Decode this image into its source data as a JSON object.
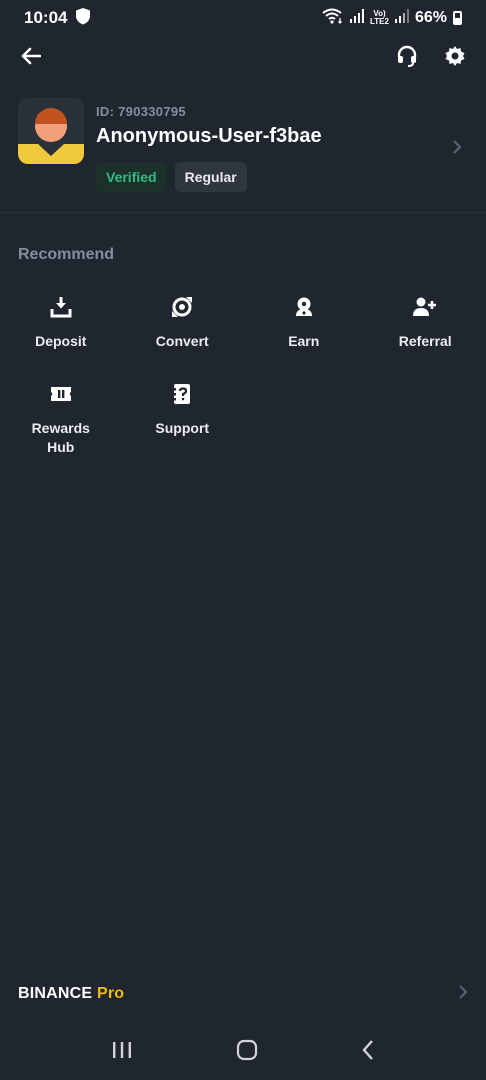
{
  "status_bar": {
    "time": "10:04",
    "net_top": "Vo)",
    "net_bottom": "LTE2",
    "battery": "66%"
  },
  "profile": {
    "id_text": "ID: 790330795",
    "username": "Anonymous-User-f3bae",
    "badge_verified": "Verified",
    "badge_regular": "Regular"
  },
  "section": {
    "title": "Recommend"
  },
  "shortcuts": [
    {
      "label": "Deposit",
      "icon": "deposit-icon"
    },
    {
      "label": "Convert",
      "icon": "convert-icon"
    },
    {
      "label": "Earn",
      "icon": "earn-icon"
    },
    {
      "label": "Referral",
      "icon": "referral-icon"
    },
    {
      "label": "Rewards Hub",
      "icon": "ticket-icon"
    },
    {
      "label": "Support",
      "icon": "support-icon"
    }
  ],
  "footer": {
    "brand": "BINANCE",
    "brand_suffix": "Pro"
  },
  "colors": {
    "background": "#1f2630",
    "accent": "#f0b90b",
    "verified": "#2ebd85",
    "muted": "#848e9c"
  }
}
